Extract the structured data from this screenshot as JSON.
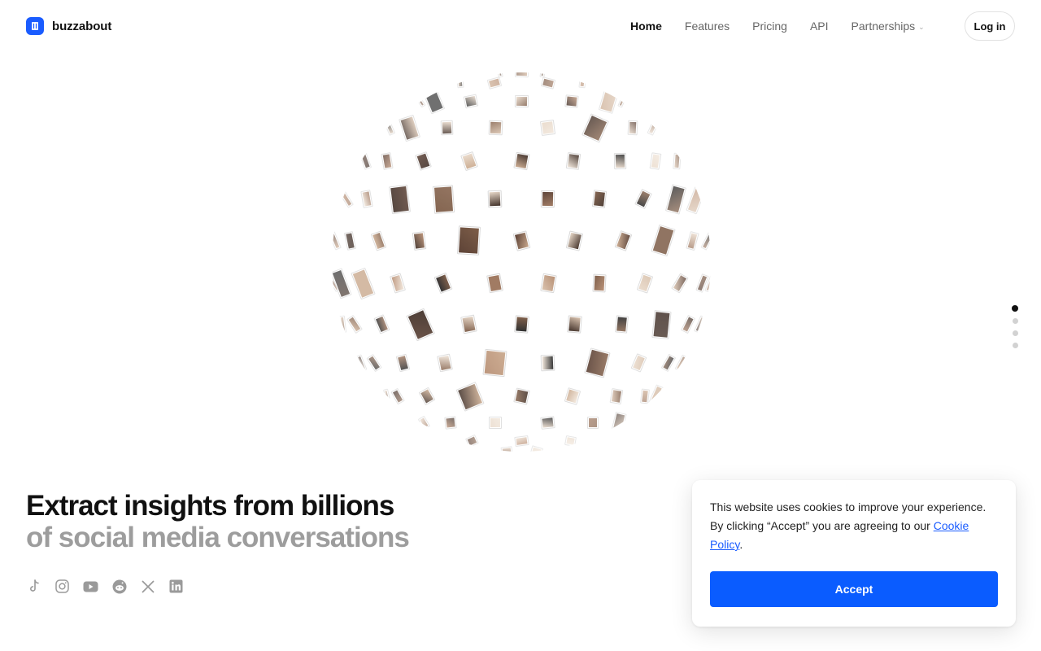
{
  "brand": {
    "name": "buzzabout",
    "color": "#1a5cff"
  },
  "nav": {
    "items": [
      {
        "label": "Home",
        "active": true
      },
      {
        "label": "Features",
        "active": false
      },
      {
        "label": "Pricing",
        "active": false
      },
      {
        "label": "API",
        "active": false
      },
      {
        "label": "Partnerships",
        "active": false,
        "has_dropdown": true
      }
    ],
    "login_label": "Log in"
  },
  "hero": {
    "headline": "Extract insights from billions",
    "subheadline": "of social media conversations"
  },
  "socials": [
    "tiktok-icon",
    "instagram-icon",
    "youtube-icon",
    "reddit-icon",
    "x-icon",
    "linkedin-icon"
  ],
  "section_dots": {
    "count": 4,
    "active": 0
  },
  "cookie_banner": {
    "text_before_link": "This website uses cookies to improve your experience. By clicking “Accept” you are agreeing to our ",
    "link_label": "Cookie Policy",
    "text_after_link": ".",
    "accept_label": "Accept",
    "accept_color": "#0a5cff"
  }
}
